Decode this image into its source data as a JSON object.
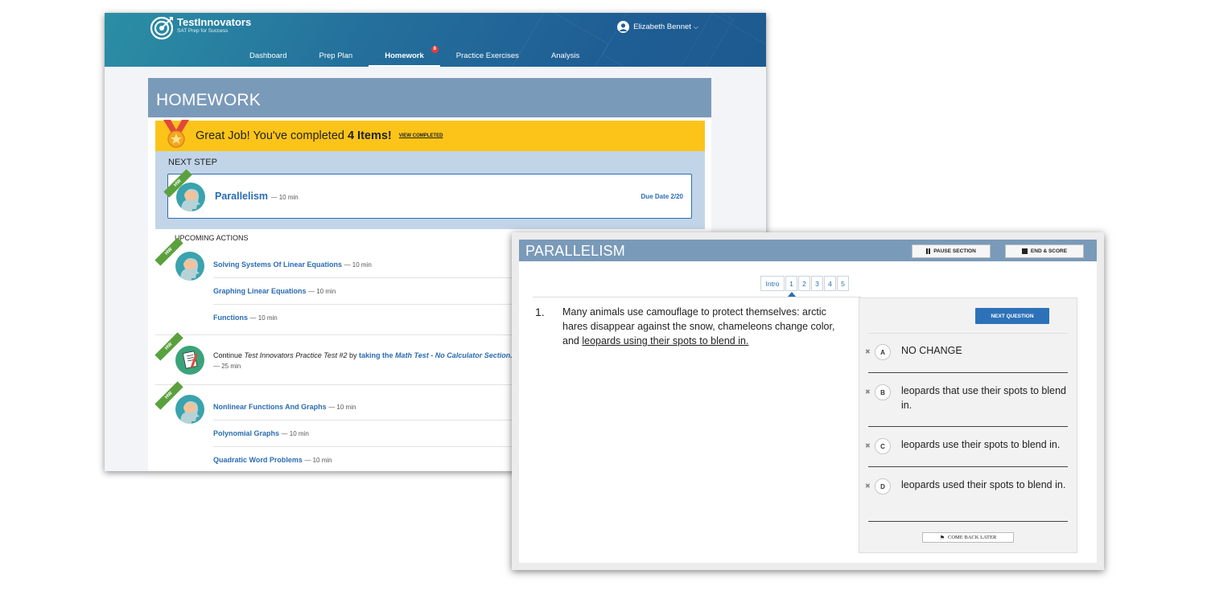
{
  "app": {
    "brand": "TestInnovators",
    "tagline": "SAT Prep for Success",
    "user_name": "Elizabeth Bennet"
  },
  "nav": {
    "items": [
      {
        "label": "Dashboard"
      },
      {
        "label": "Prep Plan"
      },
      {
        "label": "Homework",
        "active": true,
        "badge": "8"
      },
      {
        "label": "Practice Exercises"
      },
      {
        "label": "Analysis"
      }
    ]
  },
  "homework": {
    "title": "HOMEWORK",
    "congrats_prefix": "Great Job! You've completed",
    "congrats_count": "4 Items!",
    "view_completed": "VIEW COMPLETED",
    "next_step_label": "NEXT STEP",
    "hw_tag": "HW",
    "next_step": {
      "title": "Parallelism",
      "duration": "— 10 min",
      "due": "Due Date 2/20"
    },
    "upcoming_label": "UPCOMING ACTIONS",
    "groups": [
      {
        "items": [
          {
            "title": "Solving Systems Of Linear Equations",
            "duration": "— 10 min"
          },
          {
            "title": "Graphing Linear Equations",
            "duration": "— 10 min"
          },
          {
            "title": "Functions",
            "duration": "— 10 min"
          }
        ]
      },
      {
        "continue_text": "Continue",
        "test_name": "Test Innovators Practice Test #2",
        "by_text": "by",
        "taking_text": "taking the",
        "section_name": "Math Test - No Calculator",
        "section_word": "Section.",
        "duration": "— 25 min"
      },
      {
        "items": [
          {
            "title": "Nonlinear Functions And Graphs",
            "duration": "— 10 min"
          },
          {
            "title": "Polynomial Graphs",
            "duration": "— 10 min"
          },
          {
            "title": "Quadratic Word Problems",
            "duration": "— 10 min"
          }
        ]
      }
    ]
  },
  "test": {
    "title": "PARALLELISM",
    "pause_label": "PAUSE SECTION",
    "end_label": "END & SCORE",
    "question_nav": [
      "Intro",
      "1",
      "2",
      "3",
      "4",
      "5"
    ],
    "current_question": "1",
    "question_number": "1.",
    "question_text_plain": "Many animals use camouflage to protect themselves: arctic hares disappear against the snow, chameleons change color, and",
    "question_text_underlined": "leopards using their spots to blend in.",
    "next_question_label": "NEXT QUESTION",
    "choices": [
      {
        "letter": "A",
        "text": "NO CHANGE"
      },
      {
        "letter": "B",
        "text": "leopards that use their spots to blend in."
      },
      {
        "letter": "C",
        "text": "leopards use their spots to blend in."
      },
      {
        "letter": "D",
        "text": "leopards used their spots to blend in."
      }
    ],
    "come_back_label": "COME BACK LATER"
  },
  "colors": {
    "header_blue": "#7a9ab9",
    "link_blue": "#2a6cb3",
    "yellow": "#fcc419",
    "hw_green": "#5aa13e",
    "badge_red": "#e83a3a"
  }
}
